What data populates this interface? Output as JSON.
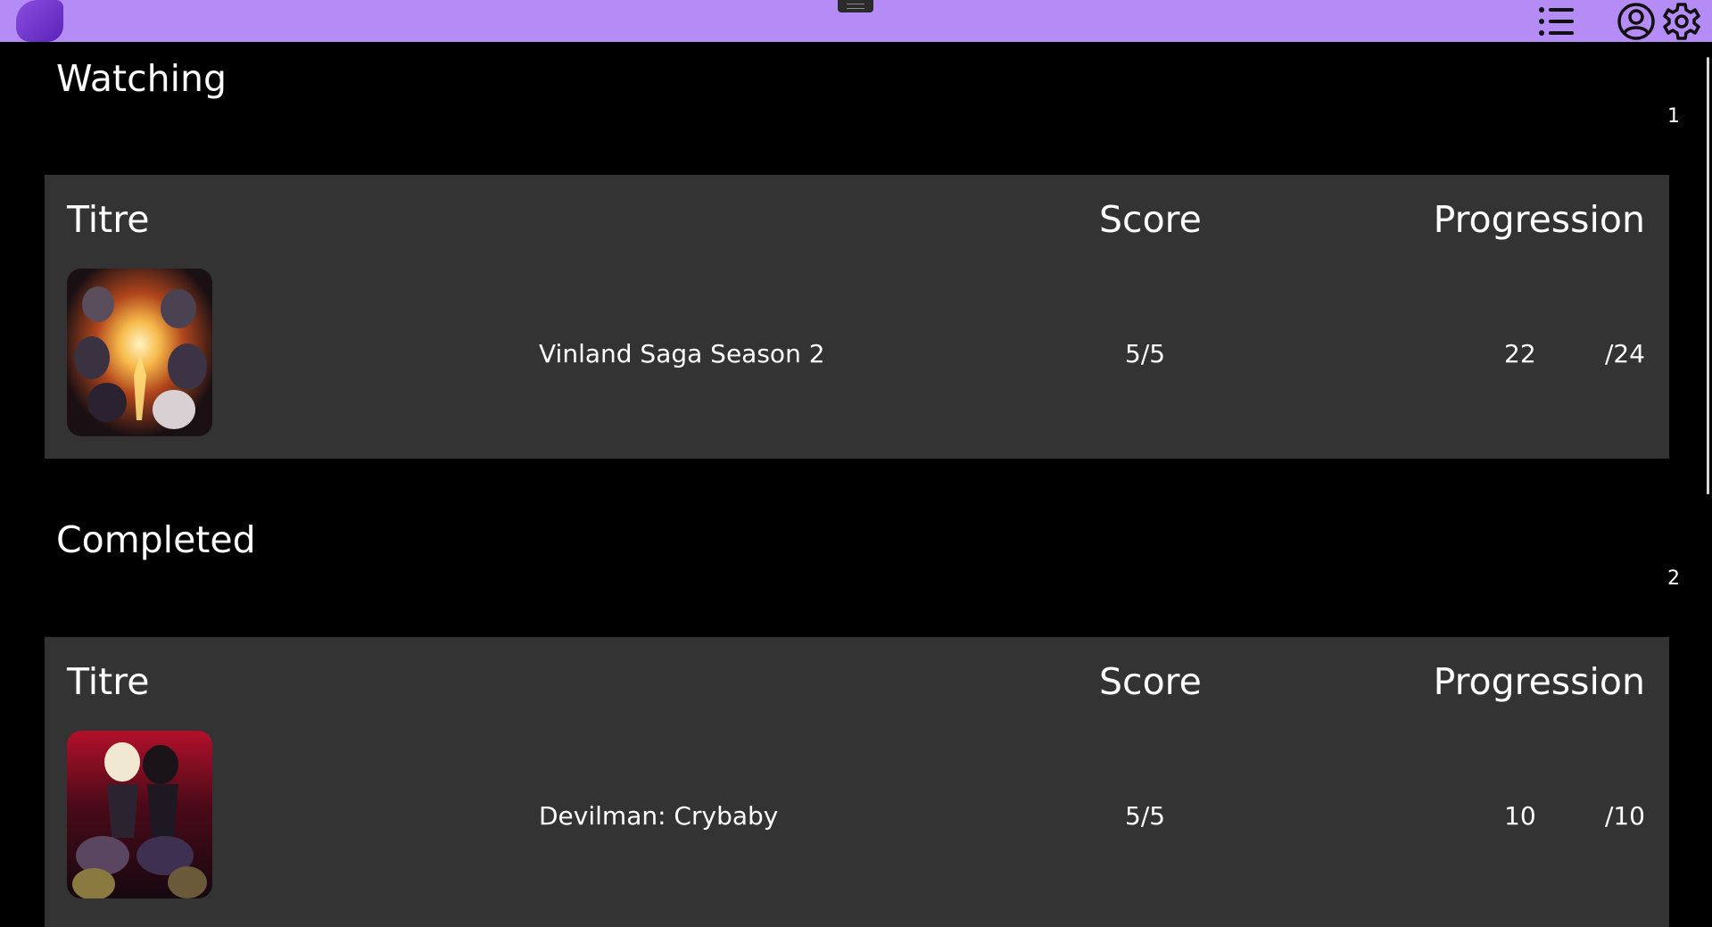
{
  "header": {
    "icons": [
      "app-logo",
      "drag-handle",
      "list-icon",
      "user-icon",
      "gear-icon"
    ],
    "accent_color": "#b58cf5"
  },
  "sections": [
    {
      "title": "Watching",
      "count": "1",
      "columns": {
        "title": "Titre",
        "score": "Score",
        "progression": "Progression"
      },
      "rows": [
        {
          "name": "Vinland Saga Season 2",
          "score": "5/5",
          "done": "22",
          "total": "/24"
        }
      ]
    },
    {
      "title": "Completed",
      "count": "2",
      "columns": {
        "title": "Titre",
        "score": "Score",
        "progression": "Progression"
      },
      "rows": [
        {
          "name": "Devilman: Crybaby",
          "score": "5/5",
          "done": "10",
          "total": "/10"
        }
      ]
    }
  ]
}
